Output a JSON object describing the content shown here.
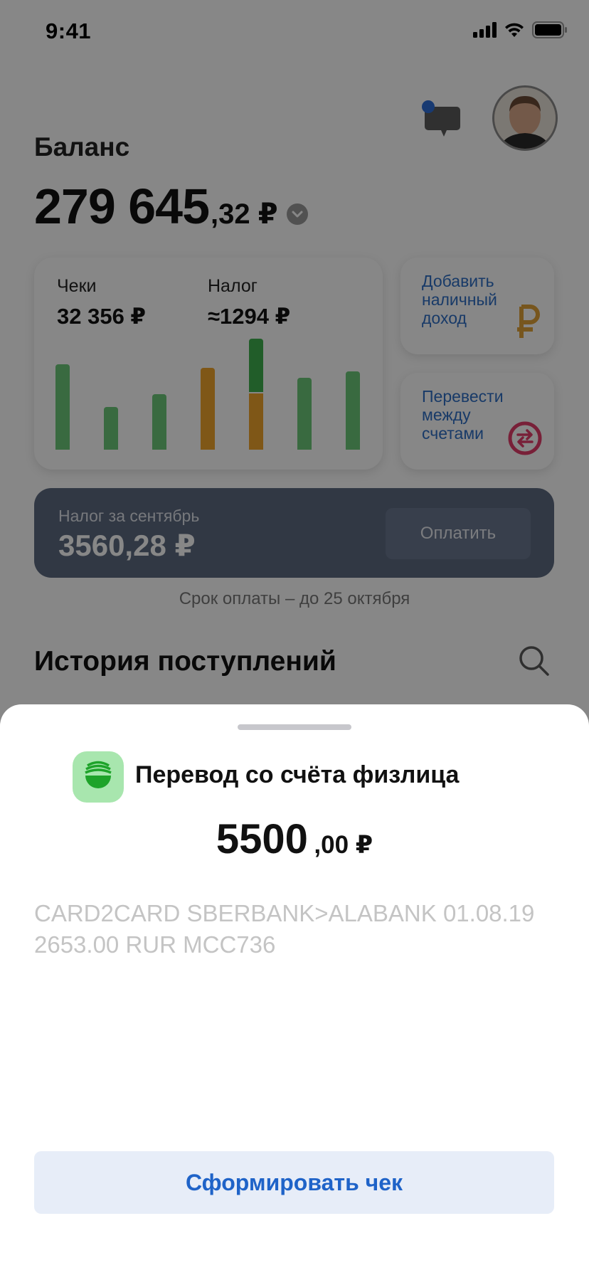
{
  "status_bar": {
    "time": "9:41"
  },
  "header": {
    "balance_label": "Баланс",
    "balance_int": "279 645",
    "balance_frac": ",32 ₽"
  },
  "stats": {
    "receipts_label": "Чеки",
    "receipts_value": "32 356 ₽",
    "tax_label": "Налог",
    "tax_value": "≈1294 ₽"
  },
  "actions": {
    "add_cash_income": "Добавить наличный доход",
    "transfer_between_accounts": "Перевести между счетами"
  },
  "tax_card": {
    "label": "Налог за сентябрь",
    "amount": "3560,28 ₽",
    "pay_button": "Оплатить",
    "due_text": "Срок оплаты – до 25 октября"
  },
  "history": {
    "title": "История поступлений"
  },
  "sheet": {
    "title": "Перевод со счёта физлица",
    "amount_int": "5500",
    "amount_frac": ",00 ₽",
    "description": "CARD2CARD SBERBANK>ALABANK 01.08.19 2653.00  RUR MCC736",
    "receipt_button": "Сформировать чек"
  },
  "colors": {
    "accent_blue": "#1f63c8",
    "bar_green": "#6cc979",
    "bar_orange": "#f0a52c",
    "tax_card_bg": "#5e6a80",
    "ruble_icon": "#e0a23a",
    "transfer_icon": "#e23d6a",
    "bank_logo_bg": "#a8e6ae",
    "bank_logo_fg": "#1ea32a",
    "notification_dot": "#2f6fd8"
  },
  "icons": {
    "chat": "chat-bubble-icon",
    "ruble": "ruble-icon",
    "transfer": "transfer-arrows-icon",
    "search": "search-icon",
    "chevron": "chevron-down-icon",
    "bank_logo": "sberbank-logo-icon"
  }
}
